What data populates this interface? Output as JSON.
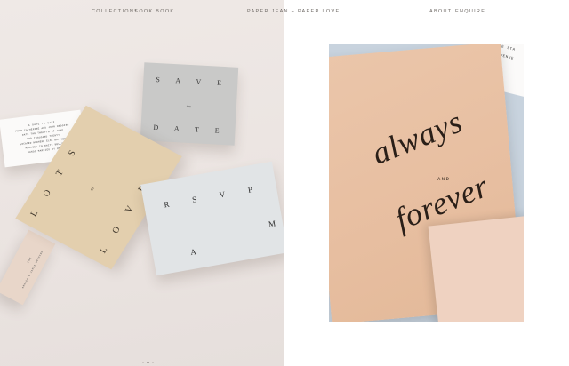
{
  "nav": {
    "collections": "COLLECTIONS",
    "lookbook": "LOOK BOOK",
    "brand": "PAPER JEAN + PAPER LOVE",
    "about": "ABOUT",
    "enquire": "ENQUIRE"
  },
  "left_photo": {
    "save_card": {
      "line1": "S A V E",
      "mid": "the",
      "line2": "D A T E"
    },
    "info_card": {
      "lines": [
        "A DATE TO SAVE",
        "FROM CATHERINE AND JOHN WEDDING",
        "DATE THE TWELFTH OF JUNE",
        "TWO THOUSAND TWENTY",
        "LOCATED NOWHERE ELSE BUT HERE",
        "MARRIED IN WHITE BELLS",
        "HANDS MARRIED BY MEN"
      ]
    },
    "lots_card": {
      "top": "L O T S",
      "mid": "of",
      "bottom": "L O V E"
    },
    "rsvp_card": {
      "top": "R S V P",
      "a": "A",
      "m": "M"
    },
    "tag_card": {
      "line1": "THE",
      "line2": "AMANDA & JAMES WEDDING"
    }
  },
  "right_photo": {
    "script_top": "always",
    "and": "AND",
    "script_bottom": "forever",
    "corner_card": {
      "line1": "RE STA",
      "line2": "VENUE"
    }
  },
  "colors": {
    "peach": "#e9c4a6",
    "sand": "#e3cfaf",
    "grey": "#c9c9c9",
    "pale_blue": "#dfe3e6",
    "blush": "#efd2c2"
  },
  "carousel": {
    "count": 3,
    "active": 1
  }
}
